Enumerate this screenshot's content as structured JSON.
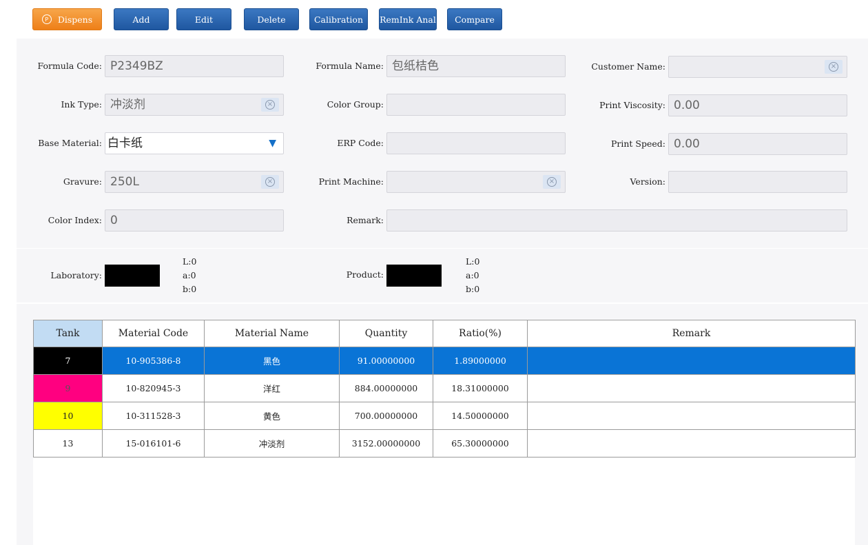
{
  "toolbar": {
    "dispense": "Dispens",
    "add": "Add",
    "edit": "Edit",
    "delete": "Delete",
    "calibration": "Calibration",
    "remink": "RemInk Anal",
    "compare": "Compare"
  },
  "form": {
    "formula_code_label": "Formula Code:",
    "formula_code": "P2349BZ",
    "formula_name_label": "Formula Name:",
    "formula_name": "包纸桔色",
    "customer_name_label": "Customer Name:",
    "customer_name": "",
    "ink_type_label": "Ink Type:",
    "ink_type": "冲淡剂",
    "color_group_label": "Color Group:",
    "color_group": "",
    "print_viscosity_label": "Print Viscosity:",
    "print_viscosity": "0.00",
    "base_material_label": "Base Material:",
    "base_material": "白卡纸",
    "erp_code_label": "ERP Code:",
    "erp_code": "",
    "print_speed_label": "Print Speed:",
    "print_speed": "0.00",
    "gravure_label": "Gravure:",
    "gravure": "250L",
    "print_machine_label": "Print Machine:",
    "print_machine": "",
    "version_label": "Version:",
    "version": "",
    "color_index_label": "Color Index:",
    "color_index": "0",
    "remark_label": "Remark:",
    "remark": ""
  },
  "colors": {
    "laboratory_label": "Laboratory:",
    "laboratory_swatch": "#000000",
    "lab_L": "L:0",
    "lab_a": "a:0",
    "lab_b": "b:0",
    "product_label": "Product:",
    "product_swatch": "#000000",
    "prod_L": "L:0",
    "prod_a": "a:0",
    "prod_b": "b:0"
  },
  "table": {
    "headers": [
      "Tank",
      "Material Code",
      "Material Name",
      "Quantity",
      "Ratio(%)",
      "Remark"
    ],
    "rows": [
      {
        "tank": "7",
        "tank_color": "#000000",
        "code": "10-905386-8",
        "name": "黑色",
        "qty": "91.00000000",
        "ratio": "1.89000000",
        "remark": ""
      },
      {
        "tank": "9",
        "tank_color": "#ff0080",
        "code": "10-820945-3",
        "name": "洋红",
        "qty": "884.00000000",
        "ratio": "18.31000000",
        "remark": ""
      },
      {
        "tank": "10",
        "tank_color": "#ffff00",
        "code": "10-311528-3",
        "name": "黄色",
        "qty": "700.00000000",
        "ratio": "14.50000000",
        "remark": ""
      },
      {
        "tank": "13",
        "tank_color": "#ffffff",
        "code": "15-016101-6",
        "name": "冲淡剂",
        "qty": "3152.00000000",
        "ratio": "65.30000000",
        "remark": ""
      }
    ]
  }
}
